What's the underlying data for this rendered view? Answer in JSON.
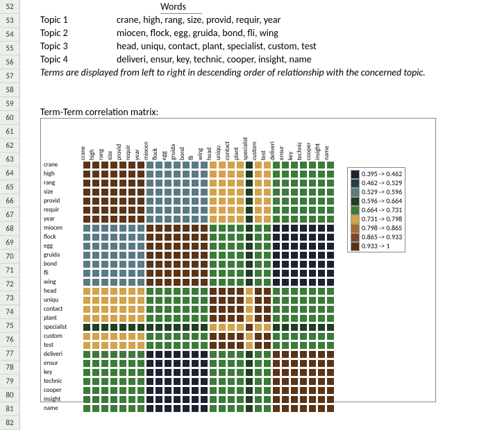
{
  "row_numbers": [
    "52",
    "53",
    "54",
    "55",
    "56",
    "57",
    "58",
    "59",
    "60",
    "61",
    "62",
    "63",
    "64",
    "65",
    "66",
    "67",
    "68",
    "69",
    "70",
    "71",
    "72",
    "73",
    "74",
    "75",
    "76",
    "77",
    "78",
    "79",
    "80",
    "81",
    "82"
  ],
  "words_header": "Words",
  "topics": [
    {
      "label": "Topic 1",
      "words": "crane, high, rang, size, provid, requir, year"
    },
    {
      "label": "Topic 2",
      "words": "miocen, flock, egg, gruida, bond, fli, wing"
    },
    {
      "label": "Topic 3",
      "words": "head, uniqu, contact, plant, specialist, custom, test"
    },
    {
      "label": "Topic 4",
      "words": "deliveri, ensur, key, technic, cooper, insight, name"
    }
  ],
  "caption": "Terms are displayed from left to right in descending order of relationship with the concerned topic.",
  "matrix_title": "Term-Term correlation matrix:",
  "terms": [
    "crane",
    "high",
    "rang",
    "size",
    "provid",
    "requir",
    "year",
    "miocen",
    "flock",
    "egg",
    "gruida",
    "bond",
    "fli",
    "wing",
    "head",
    "uniqu",
    "contact",
    "plant",
    "specialist",
    "custom",
    "test",
    "deliveri",
    "ensur",
    "key",
    "technic",
    "cooper",
    "insight",
    "name"
  ],
  "legend": [
    {
      "label": "0.395 -> 0.462",
      "color": "#1b2230"
    },
    {
      "label": "0.462 -> 0.529",
      "color": "#2a3d44"
    },
    {
      "label": "0.529 -> 0.596",
      "color": "#5a7a84"
    },
    {
      "label": "0.596 -> 0.664",
      "color": "#1e3f20"
    },
    {
      "label": "0.664 -> 0.731",
      "color": "#3c7a3a"
    },
    {
      "label": "0.731 -> 0.798",
      "color": "#d2a24c"
    },
    {
      "label": "0.798 -> 0.865",
      "color": "#a86a2e"
    },
    {
      "label": "0.865 -> 0.933",
      "color": "#7a4a22"
    },
    {
      "label": "0.933 -> 1",
      "color": "#5a3418"
    }
  ],
  "chart_data": {
    "type": "heatmap",
    "title": "Term-Term correlation matrix",
    "xlabel": "",
    "ylabel": "",
    "x": [
      "crane",
      "high",
      "rang",
      "size",
      "provid",
      "requir",
      "year",
      "miocen",
      "flock",
      "egg",
      "gruida",
      "bond",
      "fli",
      "wing",
      "head",
      "uniqu",
      "contact",
      "plant",
      "specialist",
      "custom",
      "test",
      "deliveri",
      "ensur",
      "key",
      "technic",
      "cooper",
      "insight",
      "name"
    ],
    "y": [
      "crane",
      "high",
      "rang",
      "size",
      "provid",
      "requir",
      "year",
      "miocen",
      "flock",
      "egg",
      "gruida",
      "bond",
      "fli",
      "wing",
      "head",
      "uniqu",
      "contact",
      "plant",
      "specialist",
      "custom",
      "test",
      "deliveri",
      "ensur",
      "key",
      "technic",
      "cooper",
      "insight",
      "name"
    ],
    "comment": "Values are color-bin indices 0..8 into legend[] (estimated from pixel colors).",
    "z": [
      [
        8,
        8,
        8,
        8,
        8,
        8,
        8,
        2,
        2,
        2,
        2,
        2,
        2,
        2,
        5,
        5,
        5,
        5,
        3,
        5,
        5,
        4,
        4,
        4,
        4,
        4,
        4,
        4
      ],
      [
        8,
        8,
        8,
        8,
        8,
        8,
        8,
        2,
        2,
        2,
        2,
        2,
        2,
        2,
        5,
        5,
        5,
        5,
        3,
        5,
        5,
        4,
        4,
        4,
        4,
        4,
        4,
        4
      ],
      [
        8,
        8,
        8,
        8,
        8,
        8,
        8,
        2,
        2,
        2,
        2,
        2,
        2,
        2,
        5,
        5,
        5,
        5,
        3,
        5,
        5,
        4,
        4,
        4,
        4,
        4,
        4,
        4
      ],
      [
        8,
        8,
        8,
        8,
        8,
        8,
        8,
        2,
        2,
        2,
        2,
        2,
        2,
        2,
        5,
        5,
        5,
        5,
        3,
        5,
        5,
        4,
        4,
        4,
        4,
        4,
        4,
        4
      ],
      [
        8,
        8,
        8,
        8,
        8,
        8,
        8,
        2,
        2,
        2,
        2,
        2,
        2,
        2,
        5,
        5,
        5,
        5,
        3,
        5,
        5,
        4,
        4,
        4,
        4,
        4,
        4,
        4
      ],
      [
        8,
        8,
        8,
        8,
        8,
        8,
        8,
        2,
        2,
        2,
        2,
        2,
        2,
        2,
        5,
        5,
        5,
        5,
        3,
        5,
        5,
        4,
        4,
        4,
        4,
        4,
        4,
        4
      ],
      [
        8,
        8,
        8,
        8,
        8,
        8,
        8,
        2,
        2,
        2,
        2,
        2,
        2,
        2,
        5,
        5,
        5,
        5,
        3,
        5,
        5,
        4,
        4,
        4,
        4,
        4,
        4,
        4
      ],
      [
        2,
        2,
        2,
        2,
        2,
        2,
        2,
        8,
        8,
        8,
        8,
        8,
        8,
        8,
        4,
        4,
        4,
        4,
        3,
        4,
        4,
        0,
        0,
        0,
        0,
        0,
        0,
        0
      ],
      [
        2,
        2,
        2,
        2,
        2,
        2,
        2,
        8,
        8,
        8,
        8,
        8,
        8,
        8,
        4,
        4,
        4,
        4,
        3,
        4,
        4,
        0,
        0,
        0,
        0,
        0,
        0,
        0
      ],
      [
        2,
        2,
        2,
        2,
        2,
        2,
        2,
        8,
        8,
        8,
        8,
        8,
        8,
        8,
        4,
        4,
        4,
        4,
        3,
        4,
        4,
        0,
        0,
        0,
        0,
        0,
        0,
        0
      ],
      [
        2,
        2,
        2,
        2,
        2,
        2,
        2,
        8,
        8,
        8,
        8,
        8,
        8,
        8,
        4,
        4,
        4,
        4,
        3,
        4,
        4,
        0,
        0,
        0,
        0,
        0,
        0,
        0
      ],
      [
        2,
        2,
        2,
        2,
        2,
        2,
        2,
        8,
        8,
        8,
        8,
        8,
        8,
        8,
        4,
        4,
        4,
        4,
        3,
        4,
        4,
        0,
        0,
        0,
        0,
        0,
        0,
        0
      ],
      [
        2,
        2,
        2,
        2,
        2,
        2,
        2,
        8,
        8,
        8,
        8,
        8,
        8,
        8,
        4,
        4,
        4,
        4,
        3,
        4,
        4,
        0,
        0,
        0,
        0,
        0,
        0,
        0
      ],
      [
        2,
        2,
        2,
        2,
        2,
        2,
        2,
        8,
        8,
        8,
        8,
        8,
        8,
        8,
        4,
        4,
        4,
        4,
        3,
        4,
        4,
        0,
        0,
        0,
        0,
        0,
        0,
        0
      ],
      [
        5,
        5,
        5,
        5,
        5,
        5,
        5,
        4,
        4,
        4,
        4,
        4,
        4,
        4,
        8,
        8,
        8,
        8,
        5,
        8,
        8,
        4,
        4,
        4,
        4,
        4,
        4,
        4
      ],
      [
        5,
        5,
        5,
        5,
        5,
        5,
        5,
        4,
        4,
        4,
        4,
        4,
        4,
        4,
        8,
        8,
        8,
        8,
        5,
        8,
        8,
        4,
        4,
        4,
        4,
        4,
        4,
        4
      ],
      [
        5,
        5,
        5,
        5,
        5,
        5,
        5,
        4,
        4,
        4,
        4,
        4,
        4,
        4,
        8,
        8,
        8,
        8,
        5,
        8,
        8,
        4,
        4,
        4,
        4,
        4,
        4,
        4
      ],
      [
        5,
        5,
        5,
        5,
        5,
        5,
        5,
        4,
        4,
        4,
        4,
        4,
        4,
        4,
        8,
        8,
        8,
        8,
        5,
        8,
        8,
        4,
        4,
        4,
        4,
        4,
        4,
        4
      ],
      [
        3,
        3,
        3,
        3,
        3,
        3,
        3,
        3,
        3,
        3,
        3,
        3,
        3,
        3,
        5,
        5,
        5,
        5,
        8,
        5,
        5,
        3,
        3,
        3,
        3,
        3,
        3,
        3
      ],
      [
        5,
        5,
        5,
        5,
        5,
        5,
        5,
        4,
        4,
        4,
        4,
        4,
        4,
        4,
        8,
        8,
        8,
        8,
        5,
        8,
        8,
        4,
        4,
        4,
        4,
        4,
        4,
        4
      ],
      [
        5,
        5,
        5,
        5,
        5,
        5,
        5,
        4,
        4,
        4,
        4,
        4,
        4,
        4,
        8,
        8,
        8,
        8,
        5,
        8,
        8,
        4,
        4,
        4,
        4,
        4,
        4,
        4
      ],
      [
        4,
        4,
        4,
        4,
        4,
        4,
        4,
        0,
        0,
        0,
        0,
        0,
        0,
        0,
        4,
        4,
        4,
        4,
        3,
        4,
        4,
        8,
        8,
        8,
        8,
        8,
        8,
        8
      ],
      [
        4,
        4,
        4,
        4,
        4,
        4,
        4,
        0,
        0,
        0,
        0,
        0,
        0,
        0,
        4,
        4,
        4,
        4,
        3,
        4,
        4,
        8,
        8,
        8,
        8,
        8,
        8,
        8
      ],
      [
        4,
        4,
        4,
        4,
        4,
        4,
        4,
        0,
        0,
        0,
        0,
        0,
        0,
        0,
        4,
        4,
        4,
        4,
        3,
        4,
        4,
        8,
        8,
        8,
        8,
        8,
        8,
        8
      ],
      [
        4,
        4,
        4,
        4,
        4,
        4,
        4,
        0,
        0,
        0,
        0,
        0,
        0,
        0,
        4,
        4,
        4,
        4,
        3,
        4,
        4,
        8,
        8,
        8,
        8,
        8,
        8,
        8
      ],
      [
        4,
        4,
        4,
        4,
        4,
        4,
        4,
        0,
        0,
        0,
        0,
        0,
        0,
        0,
        4,
        4,
        4,
        4,
        3,
        4,
        4,
        8,
        8,
        8,
        8,
        8,
        8,
        8
      ],
      [
        4,
        4,
        4,
        4,
        4,
        4,
        4,
        0,
        0,
        0,
        0,
        0,
        0,
        0,
        4,
        4,
        4,
        4,
        3,
        4,
        4,
        8,
        8,
        8,
        8,
        8,
        8,
        8
      ],
      [
        4,
        4,
        4,
        4,
        4,
        4,
        4,
        0,
        0,
        0,
        0,
        0,
        0,
        0,
        4,
        4,
        4,
        4,
        3,
        4,
        4,
        8,
        8,
        8,
        8,
        8,
        8,
        8
      ]
    ]
  }
}
